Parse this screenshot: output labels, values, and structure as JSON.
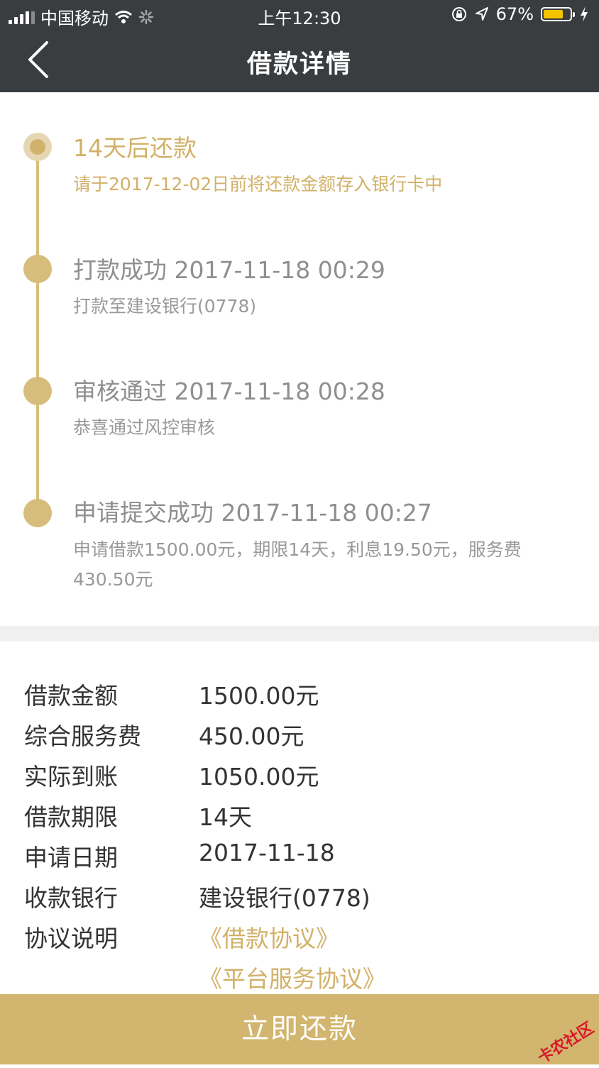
{
  "status_bar": {
    "carrier": "中国移动",
    "time": "上午12:30",
    "battery_percent": "67%"
  },
  "nav": {
    "title": "借款详情"
  },
  "timeline": [
    {
      "title": "14天后还款",
      "subtitle": "请于2017-12-02日前将还款金额存入银行卡中",
      "active": true
    },
    {
      "title": "打款成功 2017-11-18 00:29",
      "subtitle": "打款至建设银行(0778)",
      "active": false
    },
    {
      "title": "审核通过 2017-11-18 00:28",
      "subtitle": "恭喜通过风控审核",
      "active": false
    },
    {
      "title": "申请提交成功 2017-11-18 00:27",
      "subtitle": "申请借款1500.00元，期限14天，利息19.50元，服务费430.50元",
      "active": false
    }
  ],
  "details": [
    {
      "label": "借款金额",
      "value": "1500.00元"
    },
    {
      "label": "综合服务费",
      "value": "450.00元"
    },
    {
      "label": "实际到账",
      "value": "1050.00元"
    },
    {
      "label": "借款期限",
      "value": "14天"
    },
    {
      "label": "申请日期",
      "value": "2017-11-18"
    },
    {
      "label": "收款银行",
      "value": "建设银行(0778)"
    },
    {
      "label": "协议说明",
      "value": "《借款协议》"
    }
  ],
  "agreement_link_2": "《平台服务协议》",
  "repay_button": "立即还款",
  "watermark": "卡农社区",
  "colors": {
    "gold": "#d2b168",
    "header": "#3a3d40",
    "button": "#d2b56e"
  }
}
